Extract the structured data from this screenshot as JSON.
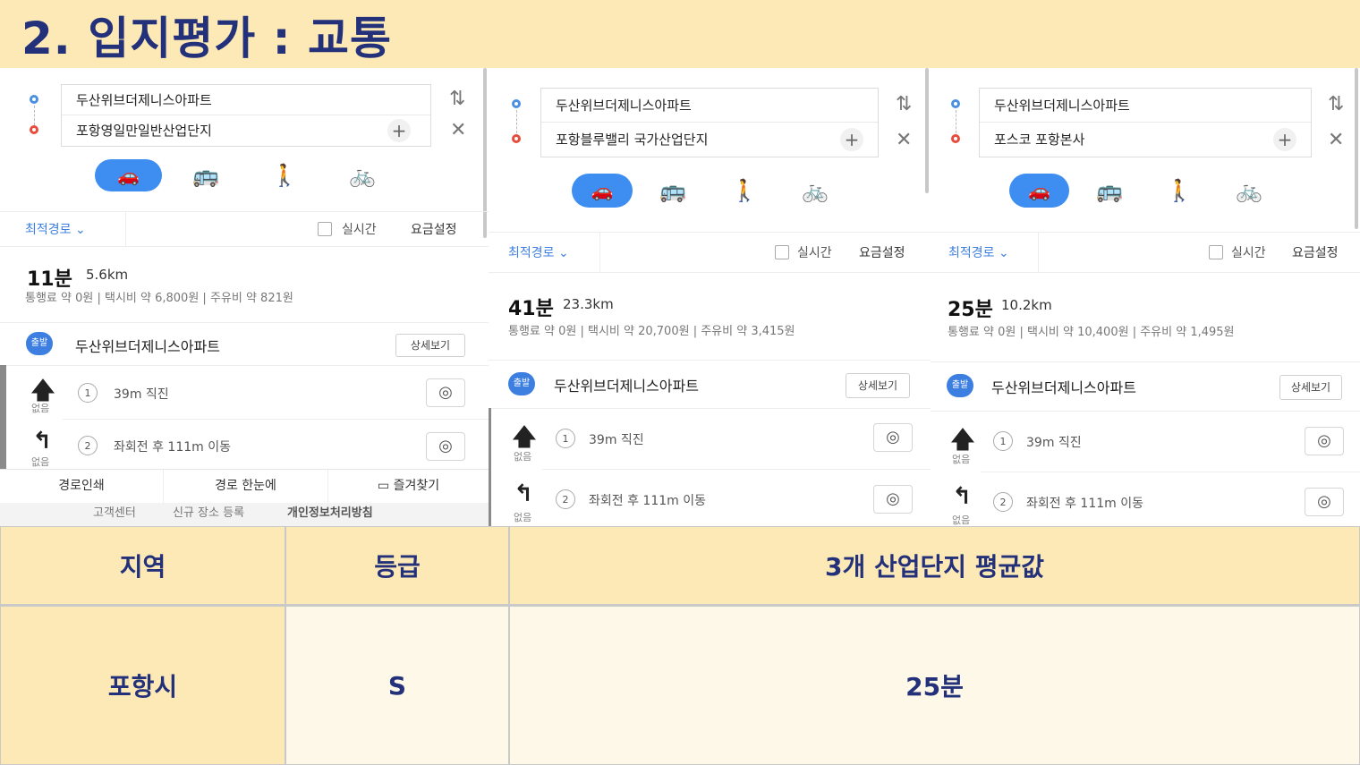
{
  "title": "2. 입지평가 : 교통",
  "panels": [
    {
      "origin": "두산위브더제니스아파트",
      "destination": "포항영일만일반산업단지",
      "best_route": "최적경로",
      "realtime": "실시간",
      "fee_setting": "요금설정",
      "time": "11분",
      "distance": "5.6km",
      "toll": "통행료 약 0원",
      "taxi": "택시비 약 6,800원",
      "fuel": "주유비 약 821원",
      "start_label": "출발",
      "start_name": "두산위브더제니스아파트",
      "detail": "상세보기",
      "steps": [
        {
          "num": "1",
          "text": "39m 직진",
          "no": "없음"
        },
        {
          "num": "2",
          "text": "좌회전 후 111m 이동",
          "no": "없음"
        }
      ],
      "print": "경로인쇄",
      "overview": "경로 한눈에",
      "favorite": "즐겨찾기",
      "footer": [
        "고객센터",
        "신규 장소 등록",
        "개인정보처리방침"
      ]
    },
    {
      "origin": "두산위브더제니스아파트",
      "destination": "포항블루밸리 국가산업단지",
      "best_route": "최적경로",
      "realtime": "실시간",
      "fee_setting": "요금설정",
      "time": "41분",
      "distance": "23.3km",
      "toll": "통행료 약 0원",
      "taxi": "택시비 약 20,700원",
      "fuel": "주유비 약 3,415원",
      "start_label": "출발",
      "start_name": "두산위브더제니스아파트",
      "detail": "상세보기",
      "steps": [
        {
          "num": "1",
          "text": "39m 직진",
          "no": "없음"
        },
        {
          "num": "2",
          "text": "좌회전 후 111m 이동",
          "no": "없음"
        }
      ]
    },
    {
      "origin": "두산위브더제니스아파트",
      "destination": "포스코 포항본사",
      "best_route": "최적경로",
      "realtime": "실시간",
      "fee_setting": "요금설정",
      "time": "25분",
      "distance": "10.2km",
      "toll": "통행료 약 0원",
      "taxi": "택시비 약 10,400원",
      "fuel": "주유비 약 1,495원",
      "start_label": "출발",
      "start_name": "두산위브더제니스아파트",
      "detail": "상세보기",
      "steps": [
        {
          "num": "1",
          "text": "39m 직진",
          "no": "없음"
        },
        {
          "num": "2",
          "text": "좌회전 후 111m 이동",
          "no": "없음"
        }
      ]
    }
  ],
  "icons": {
    "swap": "⇅",
    "close": "✕",
    "plus": "+",
    "car": "🚗",
    "bus": "🚌",
    "walk": "🚶",
    "bike": "🚲",
    "chevron": "⌄",
    "straight": "🡅",
    "left_turn": "↰",
    "camera": "◎",
    "bookmark": "▭"
  },
  "table": {
    "headers": [
      "지역",
      "등급",
      "3개 산업단지 평균값"
    ],
    "row": [
      "포항시",
      "S",
      "25분"
    ]
  }
}
